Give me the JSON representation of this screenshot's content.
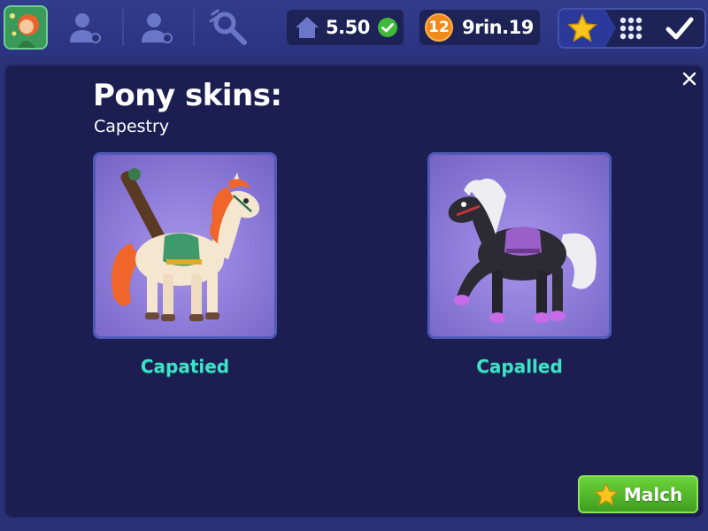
{
  "topbar": {
    "currency_value": "5.50",
    "level": "12",
    "level_text": "9rin.19"
  },
  "panel": {
    "title": "Pony skins:",
    "subtitle": "Capestry",
    "cards": [
      {
        "label": "Capatied"
      },
      {
        "label": "Capalled"
      }
    ],
    "match_label": "Malch"
  },
  "colors": {
    "bar_bg": "#2a3276",
    "panel_bg": "#1c1e52",
    "card_bg": "#8c7ad9",
    "label_teal": "#3fe0c8",
    "button_green": "#4caf25",
    "level_orange": "#f08a1c",
    "star_yellow": "#f7c51e"
  },
  "icons": {
    "avatar": "character-avatar",
    "nav": [
      "friend-icon",
      "friend-icon",
      "search-icon"
    ],
    "currency": "home-icon",
    "currency_badge": "check-badge-icon",
    "tools": [
      "star-icon",
      "grid-icon",
      "checkmark-icon"
    ],
    "close": "close-icon",
    "match": "star-icon"
  }
}
